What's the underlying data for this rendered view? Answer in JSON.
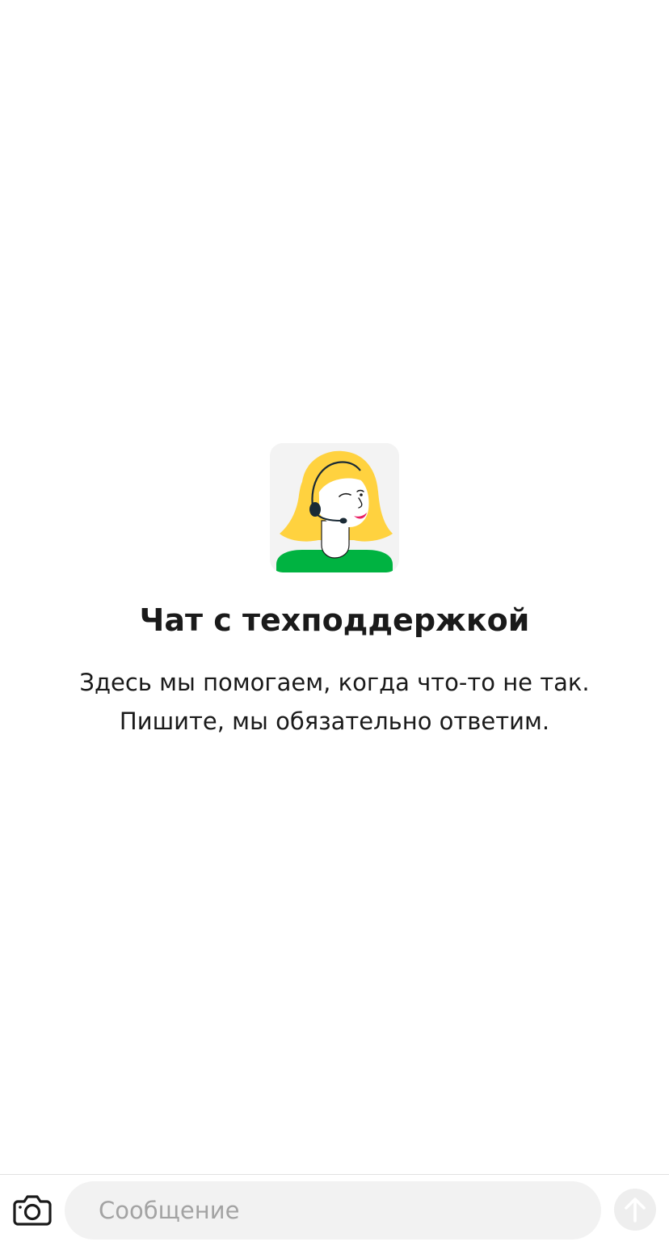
{
  "empty_state": {
    "avatar_icon": "support-agent-headset-illustration",
    "title": "Чат с техподдержкой",
    "description_line1": "Здесь мы помогаем, когда что-то не так.",
    "description_line2": "Пишите, мы обязательно ответим."
  },
  "composer": {
    "attach_icon": "camera-icon",
    "message_placeholder": "Сообщение",
    "message_value": "",
    "send_icon": "arrow-up-icon"
  },
  "colors": {
    "hair": "#FFD23F",
    "shirt": "#00B341",
    "lips": "#E91E63",
    "avatar_bg": "#F3F3F3",
    "input_bg": "#F2F2F2",
    "placeholder": "#A3A3A3",
    "send_bg": "#EEEEEE"
  }
}
